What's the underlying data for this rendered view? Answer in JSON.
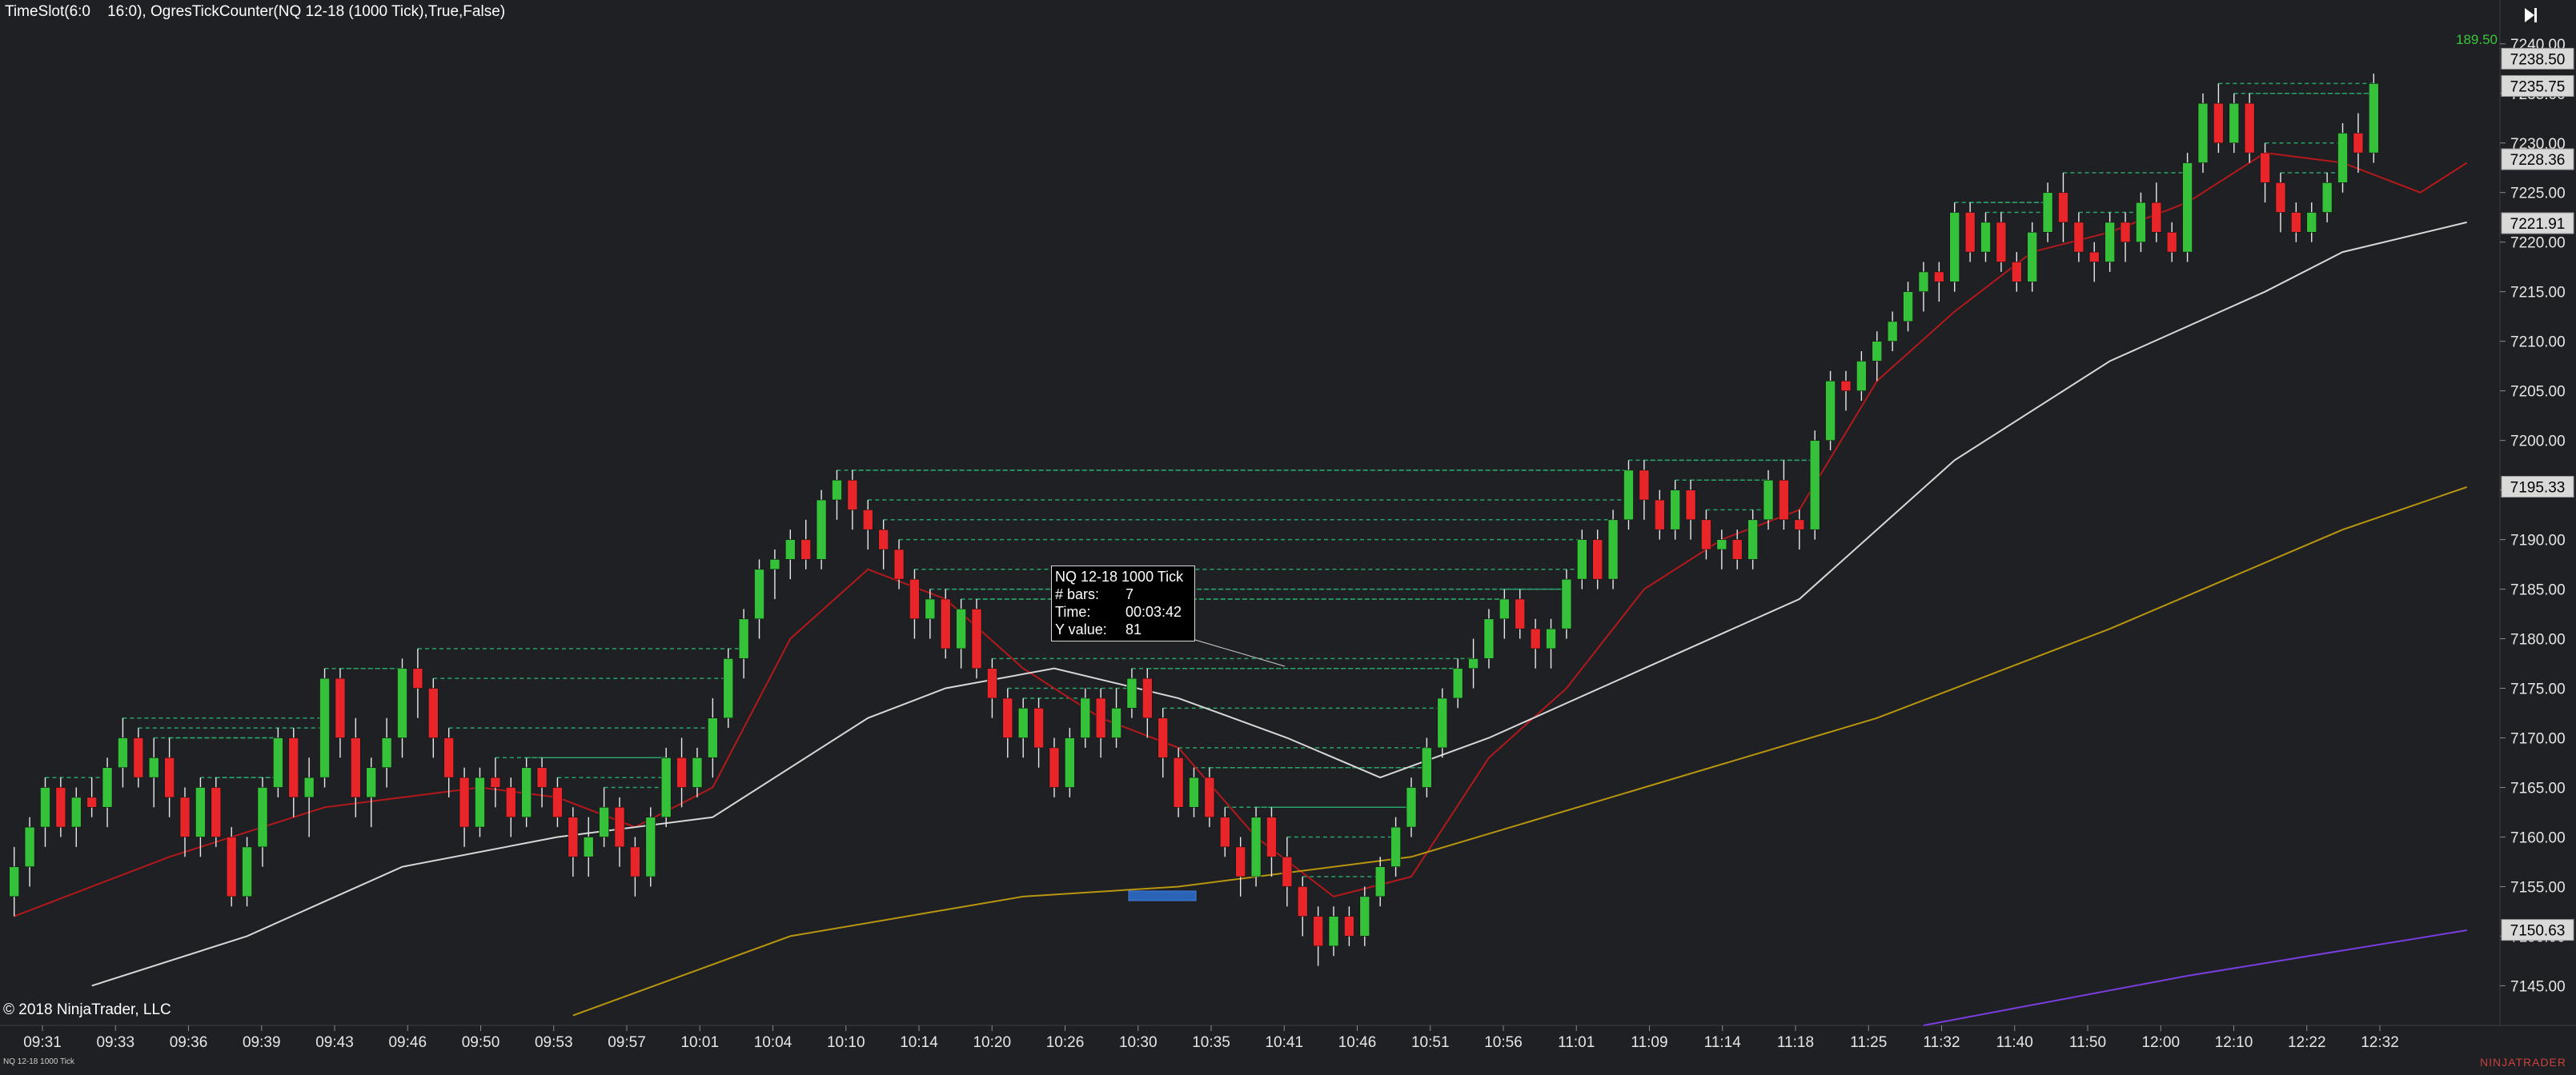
{
  "header": {
    "title": "TimeSlot(6:0    16:0), OgresTickCounter(NQ 12-18 (1000 Tick),True,False)",
    "tick_counter": "189.50"
  },
  "footer": {
    "copyright": "© 2018 NinjaTrader, LLC",
    "instrument_tag": "NQ 12-18 1000 Tick",
    "brand": "NINJATRADER"
  },
  "tooltip": {
    "title": "NQ 12-18 1000 Tick",
    "rows": [
      {
        "label": "# bars:",
        "value": "7"
      },
      {
        "label": "Time:",
        "value": "00:03:42"
      },
      {
        "label": "Y value:",
        "value": "81"
      }
    ]
  },
  "colors": {
    "background": "#1f2023",
    "bull": "#35c13a",
    "bear": "#e8262a",
    "sma_fast": "#b3191c",
    "sma_mid": "#d8d8d8",
    "sma_slow": "#b8960f",
    "sma_purple": "#7a3ee0",
    "hline": "#2aa36b",
    "counter": "#3cc43c",
    "axis_text": "#e6e6e6"
  },
  "chart_data": {
    "type": "candlestick",
    "instrument": "NQ 12-18",
    "bar_type": "1000 Tick",
    "ylim": [
      7141,
      7242
    ],
    "y_ticks": [
      7145,
      7150,
      7155,
      7160,
      7165,
      7170,
      7175,
      7180,
      7185,
      7190,
      7195,
      7200,
      7205,
      7210,
      7215,
      7220,
      7225,
      7230,
      7235,
      7240
    ],
    "y_tick_labels": [
      "7145.00",
      "7150.00",
      "7155.00",
      "7160.00",
      "7165.00",
      "7170.00",
      "7175.00",
      "7180.00",
      "7185.00",
      "7190.00",
      "7195.00",
      "7200.00",
      "7205.00",
      "7210.00",
      "7215.00",
      "7220.00",
      "7225.00",
      "7230.00",
      "7235.00",
      "7240.00"
    ],
    "x_tick_labels": [
      "09:31",
      "09:33",
      "09:36",
      "09:39",
      "09:43",
      "09:46",
      "09:50",
      "09:53",
      "09:57",
      "10:01",
      "10:04",
      "10:10",
      "10:14",
      "10:20",
      "10:26",
      "10:30",
      "10:35",
      "10:41",
      "10:46",
      "10:51",
      "10:56",
      "11:01",
      "11:09",
      "11:14",
      "11:18",
      "11:25",
      "11:32",
      "11:40",
      "11:50",
      "12:00",
      "12:10",
      "12:22",
      "12:32"
    ],
    "price_markers": [
      {
        "label": "7238.50",
        "value": 7238.5
      },
      {
        "label": "7235.75",
        "value": 7235.75
      },
      {
        "label": "7228.36",
        "value": 7228.36
      },
      {
        "label": "7221.91",
        "value": 7221.91
      },
      {
        "label": "7195.33",
        "value": 7195.33
      },
      {
        "label": "7150.63",
        "value": 7150.63
      }
    ],
    "candles": [
      [
        7154,
        7159,
        7152,
        7157
      ],
      [
        7157,
        7162,
        7155,
        7161
      ],
      [
        7161,
        7166,
        7159,
        7165
      ],
      [
        7165,
        7166,
        7160,
        7161
      ],
      [
        7161,
        7165,
        7159,
        7164
      ],
      [
        7164,
        7166,
        7162,
        7163
      ],
      [
        7163,
        7168,
        7161,
        7167
      ],
      [
        7167,
        7172,
        7165,
        7170
      ],
      [
        7170,
        7171,
        7165,
        7166
      ],
      [
        7166,
        7170,
        7163,
        7168
      ],
      [
        7168,
        7170,
        7162,
        7164
      ],
      [
        7164,
        7165,
        7158,
        7160
      ],
      [
        7160,
        7166,
        7158,
        7165
      ],
      [
        7165,
        7166,
        7159,
        7160
      ],
      [
        7160,
        7161,
        7153,
        7154
      ],
      [
        7154,
        7160,
        7153,
        7159
      ],
      [
        7159,
        7166,
        7157,
        7165
      ],
      [
        7165,
        7171,
        7164,
        7170
      ],
      [
        7170,
        7171,
        7162,
        7164
      ],
      [
        7164,
        7168,
        7160,
        7166
      ],
      [
        7166,
        7177,
        7165,
        7176
      ],
      [
        7176,
        7177,
        7168,
        7170
      ],
      [
        7170,
        7172,
        7162,
        7164
      ],
      [
        7164,
        7168,
        7161,
        7167
      ],
      [
        7167,
        7172,
        7165,
        7170
      ],
      [
        7170,
        7178,
        7168,
        7177
      ],
      [
        7177,
        7179,
        7172,
        7175
      ],
      [
        7175,
        7176,
        7168,
        7170
      ],
      [
        7170,
        7171,
        7164,
        7166
      ],
      [
        7166,
        7167,
        7159,
        7161
      ],
      [
        7161,
        7167,
        7160,
        7166
      ],
      [
        7166,
        7168,
        7163,
        7165
      ],
      [
        7165,
        7166,
        7160,
        7162
      ],
      [
        7162,
        7168,
        7161,
        7167
      ],
      [
        7167,
        7168,
        7163,
        7165
      ],
      [
        7165,
        7166,
        7161,
        7162
      ],
      [
        7162,
        7163,
        7156,
        7158
      ],
      [
        7158,
        7162,
        7156,
        7160
      ],
      [
        7160,
        7165,
        7159,
        7163
      ],
      [
        7163,
        7164,
        7157,
        7159
      ],
      [
        7159,
        7160,
        7154,
        7156
      ],
      [
        7156,
        7163,
        7155,
        7162
      ],
      [
        7162,
        7169,
        7161,
        7168
      ],
      [
        7168,
        7170,
        7163,
        7165
      ],
      [
        7165,
        7169,
        7164,
        7168
      ],
      [
        7168,
        7174,
        7166,
        7172
      ],
      [
        7172,
        7179,
        7171,
        7178
      ],
      [
        7178,
        7183,
        7176,
        7182
      ],
      [
        7182,
        7188,
        7180,
        7187
      ],
      [
        7187,
        7189,
        7184,
        7188
      ],
      [
        7188,
        7191,
        7186,
        7190
      ],
      [
        7190,
        7192,
        7187,
        7188
      ],
      [
        7188,
        7195,
        7187,
        7194
      ],
      [
        7194,
        7197,
        7192,
        7196
      ],
      [
        7196,
        7197,
        7191,
        7193
      ],
      [
        7193,
        7194,
        7189,
        7191
      ],
      [
        7191,
        7192,
        7187,
        7189
      ],
      [
        7189,
        7190,
        7185,
        7186
      ],
      [
        7186,
        7187,
        7180,
        7182
      ],
      [
        7182,
        7185,
        7180,
        7184
      ],
      [
        7184,
        7185,
        7178,
        7179
      ],
      [
        7179,
        7184,
        7177,
        7183
      ],
      [
        7183,
        7184,
        7176,
        7177
      ],
      [
        7177,
        7178,
        7172,
        7174
      ],
      [
        7174,
        7175,
        7168,
        7170
      ],
      [
        7170,
        7174,
        7168,
        7173
      ],
      [
        7173,
        7174,
        7167,
        7169
      ],
      [
        7169,
        7170,
        7164,
        7165
      ],
      [
        7165,
        7171,
        7164,
        7170
      ],
      [
        7170,
        7175,
        7169,
        7174
      ],
      [
        7174,
        7175,
        7168,
        7170
      ],
      [
        7170,
        7175,
        7169,
        7173
      ],
      [
        7173,
        7177,
        7172,
        7176
      ],
      [
        7176,
        7177,
        7170,
        7172
      ],
      [
        7172,
        7173,
        7166,
        7168
      ],
      [
        7168,
        7169,
        7162,
        7163
      ],
      [
        7163,
        7167,
        7162,
        7166
      ],
      [
        7166,
        7167,
        7161,
        7162
      ],
      [
        7162,
        7163,
        7158,
        7159
      ],
      [
        7159,
        7160,
        7154,
        7156
      ],
      [
        7156,
        7163,
        7155,
        7162
      ],
      [
        7162,
        7163,
        7156,
        7158
      ],
      [
        7158,
        7160,
        7153,
        7155
      ],
      [
        7155,
        7156,
        7150,
        7152
      ],
      [
        7152,
        7153,
        7147,
        7149
      ],
      [
        7149,
        7153,
        7148,
        7152
      ],
      [
        7152,
        7153,
        7149,
        7150
      ],
      [
        7150,
        7155,
        7149,
        7154
      ],
      [
        7154,
        7158,
        7153,
        7157
      ],
      [
        7157,
        7162,
        7156,
        7161
      ],
      [
        7161,
        7166,
        7160,
        7165
      ],
      [
        7165,
        7170,
        7164,
        7169
      ],
      [
        7169,
        7175,
        7168,
        7174
      ],
      [
        7174,
        7178,
        7173,
        7177
      ],
      [
        7177,
        7180,
        7175,
        7178
      ],
      [
        7178,
        7183,
        7177,
        7182
      ],
      [
        7182,
        7185,
        7180,
        7184
      ],
      [
        7184,
        7185,
        7180,
        7181
      ],
      [
        7181,
        7182,
        7177,
        7179
      ],
      [
        7179,
        7182,
        7177,
        7181
      ],
      [
        7181,
        7187,
        7180,
        7186
      ],
      [
        7186,
        7191,
        7185,
        7190
      ],
      [
        7190,
        7191,
        7185,
        7186
      ],
      [
        7186,
        7193,
        7185,
        7192
      ],
      [
        7192,
        7198,
        7191,
        7197
      ],
      [
        7197,
        7198,
        7192,
        7194
      ],
      [
        7194,
        7195,
        7190,
        7191
      ],
      [
        7191,
        7196,
        7190,
        7195
      ],
      [
        7195,
        7196,
        7190,
        7192
      ],
      [
        7192,
        7193,
        7188,
        7189
      ],
      [
        7189,
        7191,
        7187,
        7190
      ],
      [
        7190,
        7191,
        7187,
        7188
      ],
      [
        7188,
        7193,
        7187,
        7192
      ],
      [
        7192,
        7197,
        7191,
        7196
      ],
      [
        7196,
        7198,
        7191,
        7192
      ],
      [
        7192,
        7193,
        7189,
        7191
      ],
      [
        7191,
        7201,
        7190,
        7200
      ],
      [
        7200,
        7207,
        7199,
        7206
      ],
      [
        7206,
        7207,
        7203,
        7205
      ],
      [
        7205,
        7209,
        7204,
        7208
      ],
      [
        7208,
        7211,
        7206,
        7210
      ],
      [
        7210,
        7213,
        7209,
        7212
      ],
      [
        7212,
        7216,
        7211,
        7215
      ],
      [
        7215,
        7218,
        7213,
        7217
      ],
      [
        7217,
        7218,
        7214,
        7216
      ],
      [
        7216,
        7224,
        7215,
        7223
      ],
      [
        7223,
        7224,
        7218,
        7219
      ],
      [
        7219,
        7223,
        7218,
        7222
      ],
      [
        7222,
        7223,
        7217,
        7218
      ],
      [
        7218,
        7219,
        7215,
        7216
      ],
      [
        7216,
        7222,
        7215,
        7221
      ],
      [
        7221,
        7226,
        7220,
        7225
      ],
      [
        7225,
        7227,
        7220,
        7222
      ],
      [
        7222,
        7223,
        7218,
        7219
      ],
      [
        7219,
        7220,
        7216,
        7218
      ],
      [
        7218,
        7223,
        7217,
        7222
      ],
      [
        7222,
        7223,
        7218,
        7220
      ],
      [
        7220,
        7225,
        7219,
        7224
      ],
      [
        7224,
        7226,
        7220,
        7221
      ],
      [
        7221,
        7222,
        7218,
        7219
      ],
      [
        7219,
        7229,
        7218,
        7228
      ],
      [
        7228,
        7235,
        7227,
        7234
      ],
      [
        7234,
        7236,
        7229,
        7230
      ],
      [
        7230,
        7235,
        7229,
        7234
      ],
      [
        7234,
        7235,
        7228,
        7229
      ],
      [
        7229,
        7230,
        7224,
        7226
      ],
      [
        7226,
        7227,
        7221,
        7223
      ],
      [
        7223,
        7224,
        7220,
        7221
      ],
      [
        7221,
        7224,
        7220,
        7223
      ],
      [
        7223,
        7227,
        7222,
        7226
      ],
      [
        7226,
        7232,
        7225,
        7231
      ],
      [
        7231,
        7233,
        7227,
        7229
      ],
      [
        7229,
        7237,
        7228,
        7236
      ]
    ],
    "series": [
      {
        "name": "SMA fast",
        "color": "#b3191c",
        "values": [
          [
            0,
            7152
          ],
          [
            10,
            7158
          ],
          [
            20,
            7163
          ],
          [
            30,
            7165
          ],
          [
            35,
            7164
          ],
          [
            40,
            7161
          ],
          [
            45,
            7165
          ],
          [
            50,
            7180
          ],
          [
            55,
            7187
          ],
          [
            60,
            7184
          ],
          [
            65,
            7177
          ],
          [
            70,
            7172
          ],
          [
            75,
            7169
          ],
          [
            80,
            7160
          ],
          [
            85,
            7154
          ],
          [
            90,
            7156
          ],
          [
            95,
            7168
          ],
          [
            100,
            7175
          ],
          [
            105,
            7185
          ],
          [
            110,
            7190
          ],
          [
            115,
            7193
          ],
          [
            120,
            7206
          ],
          [
            125,
            7213
          ],
          [
            130,
            7219
          ],
          [
            135,
            7221
          ],
          [
            140,
            7224
          ],
          [
            145,
            7229
          ],
          [
            150,
            7228
          ],
          [
            155,
            7225
          ],
          [
            158,
            7228
          ]
        ]
      },
      {
        "name": "SMA mid",
        "color": "#d8d8d8",
        "values": [
          [
            5,
            7145
          ],
          [
            15,
            7150
          ],
          [
            25,
            7157
          ],
          [
            35,
            7160
          ],
          [
            45,
            7162
          ],
          [
            55,
            7172
          ],
          [
            60,
            7175
          ],
          [
            67,
            7177
          ],
          [
            75,
            7174
          ],
          [
            82,
            7170
          ],
          [
            88,
            7166
          ],
          [
            95,
            7170
          ],
          [
            105,
            7177
          ],
          [
            115,
            7184
          ],
          [
            125,
            7198
          ],
          [
            135,
            7208
          ],
          [
            145,
            7215
          ],
          [
            150,
            7219
          ],
          [
            158,
            7222
          ]
        ]
      },
      {
        "name": "SMA slow",
        "color": "#b8960f",
        "values": [
          [
            36,
            7142
          ],
          [
            50,
            7150
          ],
          [
            65,
            7154
          ],
          [
            75,
            7155
          ],
          [
            90,
            7158
          ],
          [
            105,
            7165
          ],
          [
            120,
            7172
          ],
          [
            135,
            7181
          ],
          [
            150,
            7191
          ],
          [
            158,
            7195.3
          ]
        ]
      },
      {
        "name": "SMA purple",
        "color": "#7a3ee0",
        "values": [
          [
            123,
            7141
          ],
          [
            140,
            7146
          ],
          [
            158,
            7150.6
          ]
        ]
      }
    ]
  }
}
